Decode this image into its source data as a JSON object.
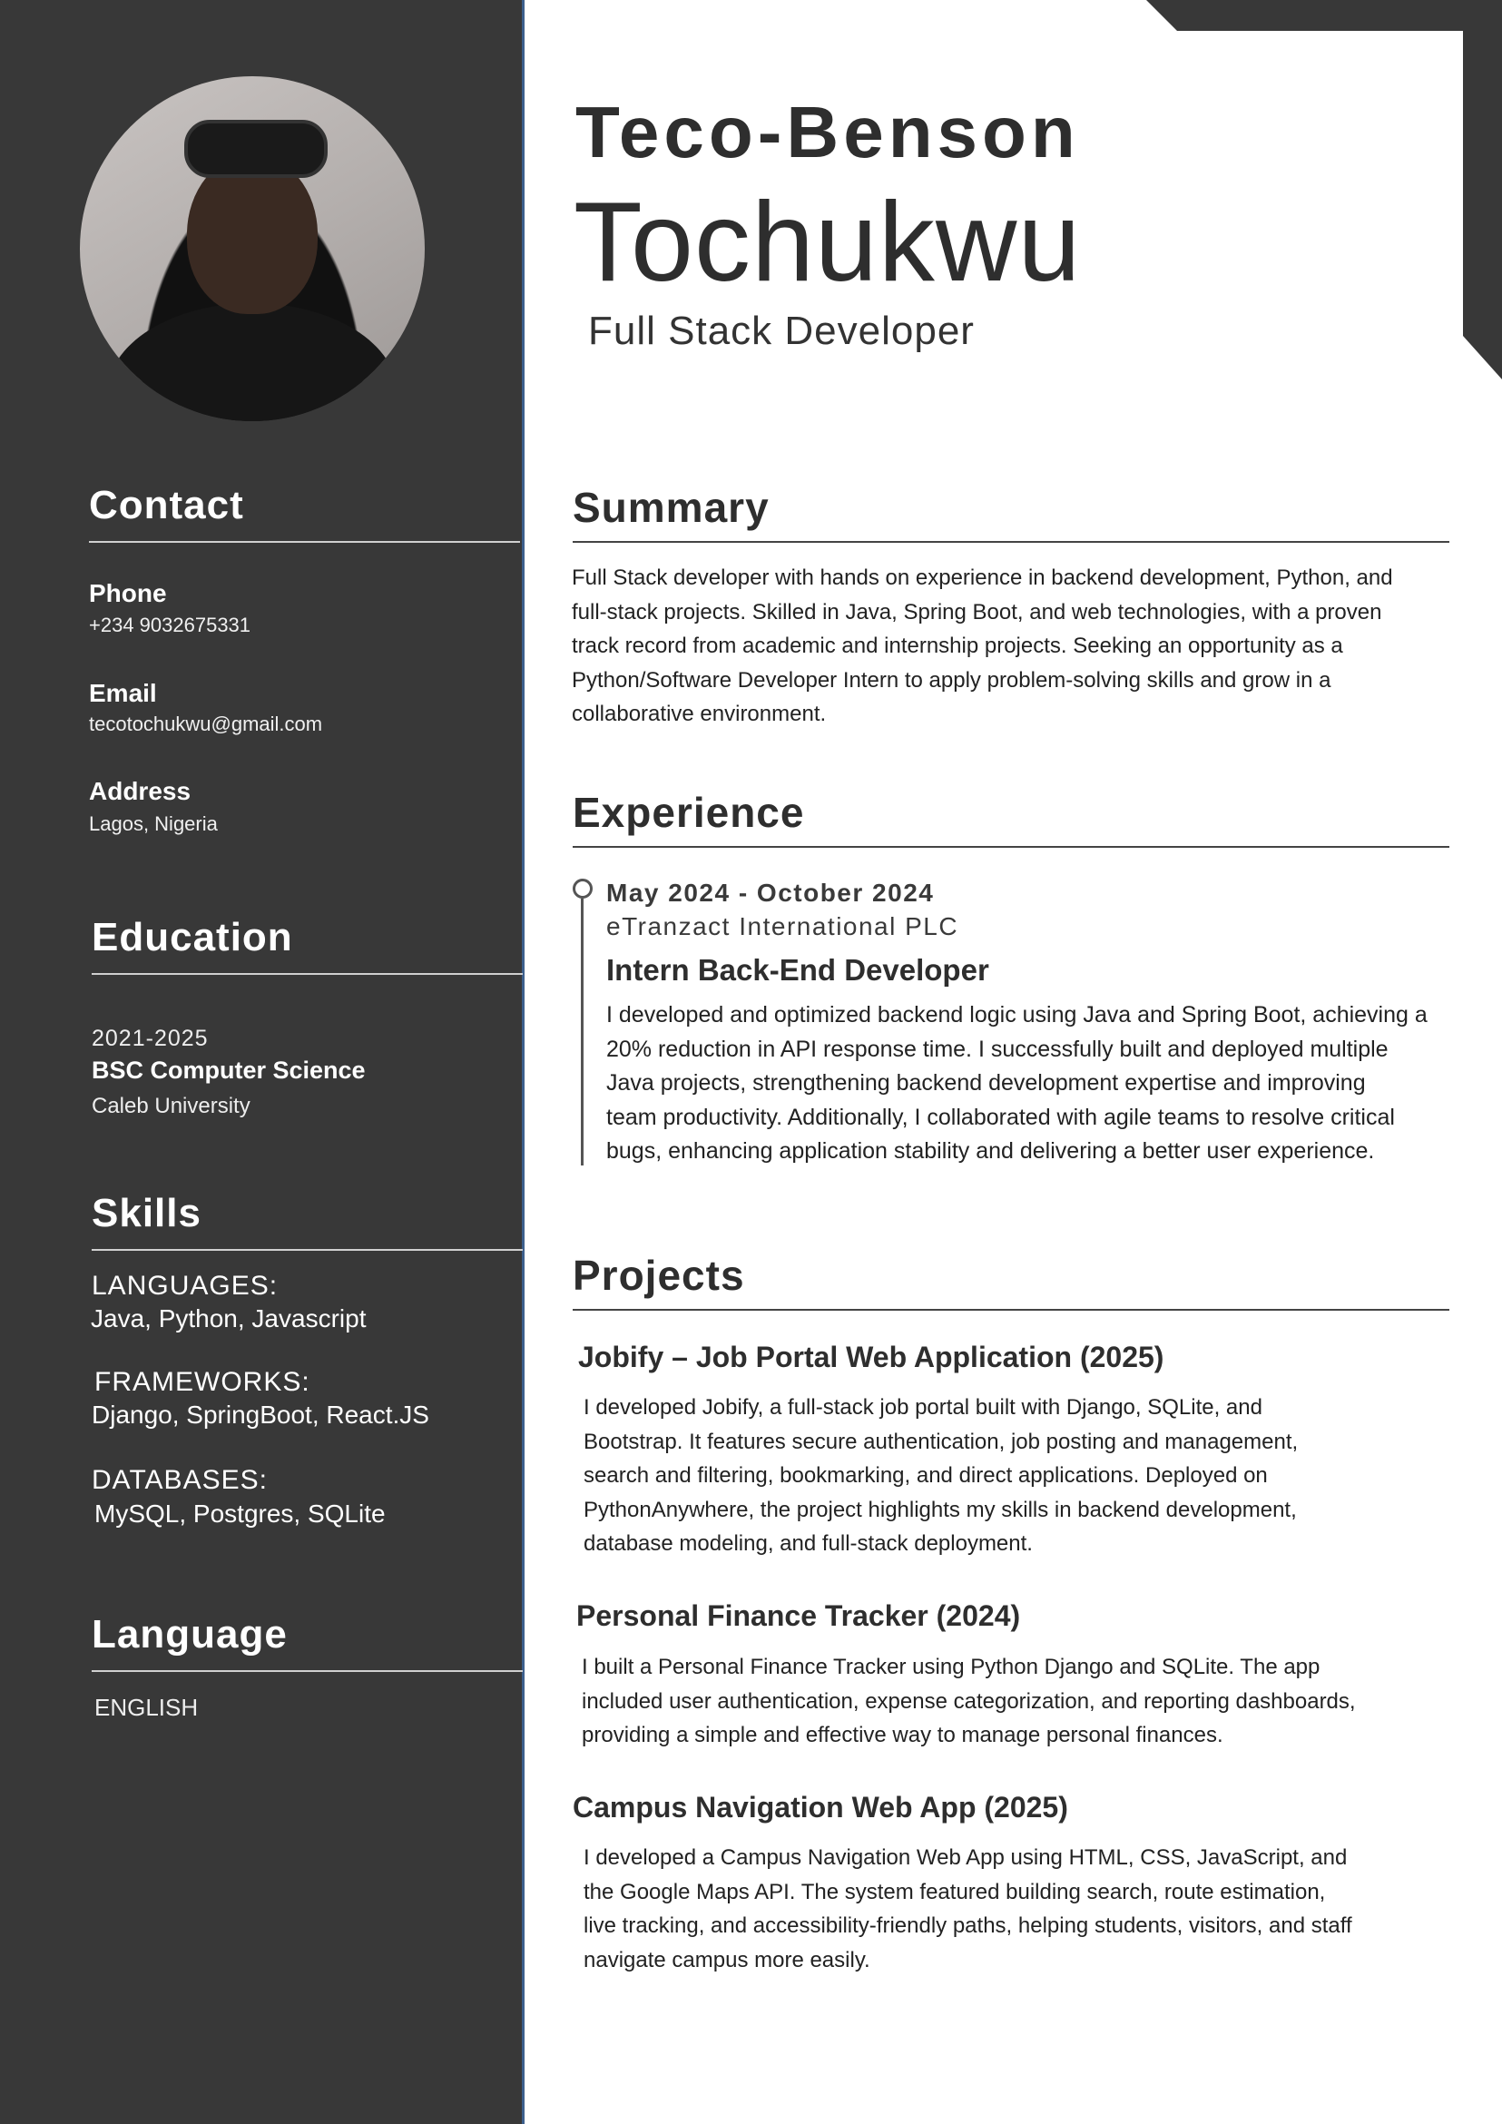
{
  "header": {
    "first_name": "Teco-Benson",
    "last_name": "Tochukwu",
    "role": "Full Stack Developer"
  },
  "sidebar": {
    "contact": {
      "heading": "Contact",
      "phone_label": "Phone",
      "phone_value": "+234 9032675331",
      "email_label": "Email",
      "email_value": "tecotochukwu@gmail.com",
      "address_label": "Address",
      "address_value": "Lagos, Nigeria"
    },
    "education": {
      "heading": "Education",
      "years": "2021-2025",
      "degree": "BSC Computer Science",
      "school": "Caleb University"
    },
    "skills": {
      "heading": "Skills",
      "groups": [
        {
          "category": "LANGUAGES:",
          "items": "Java, Python, Javascript"
        },
        {
          "category": "FRAMEWORKS:",
          "items": "Django, SpringBoot, React.JS"
        },
        {
          "category": "DATABASES:",
          "items": "MySQL, Postgres, SQLite"
        }
      ]
    },
    "language": {
      "heading": "Language",
      "items": [
        "ENGLISH"
      ]
    }
  },
  "summary": {
    "heading": "Summary",
    "lines": [
      "Full Stack developer with hands on experience in backend development, Python, and",
      "full-stack projects. Skilled in Java, Spring Boot, and web technologies, with a proven",
      "track record from academic and internship projects. Seeking an opportunity as a",
      "Python/Software Developer Intern to apply problem-solving skills and grow in a",
      "collaborative environment."
    ]
  },
  "experience": {
    "heading": "Experience",
    "date": "May 2024 - October 2024",
    "company": "eTranzact International PLC",
    "role": "Intern Back-End Developer",
    "lines": [
      "I developed and optimized backend logic using Java and Spring Boot, achieving a",
      "20% reduction in API response time. I successfully built and deployed multiple",
      "Java projects, strengthening backend development expertise and improving",
      "team productivity. Additionally, I collaborated with agile teams to resolve critical",
      "bugs, enhancing application stability and delivering a better user experience."
    ]
  },
  "projects": {
    "heading": "Projects",
    "items": [
      {
        "title": "Jobify – Job Portal Web Application (2025)",
        "lines": [
          "I developed Jobify, a full-stack job portal built with Django, SQLite, and",
          "Bootstrap. It features secure authentication, job posting and management,",
          "search and filtering, bookmarking, and direct applications. Deployed on",
          "PythonAnywhere, the project highlights my skills in backend development,",
          "database modeling, and full-stack deployment."
        ]
      },
      {
        "title": "Personal Finance Tracker (2024)",
        "lines": [
          "I built a Personal Finance Tracker using Python Django and SQLite. The app",
          "included user authentication, expense categorization, and reporting dashboards,",
          "providing a simple and effective way to manage personal finances."
        ]
      },
      {
        "title": "Campus Navigation Web App (2025)",
        "lines": [
          "I developed a Campus Navigation Web App using HTML, CSS, JavaScript, and",
          "the Google Maps API. The system featured building search, route estimation,",
          "live tracking, and accessibility-friendly paths, helping students, visitors, and staff",
          "navigate campus more easily."
        ]
      }
    ]
  }
}
